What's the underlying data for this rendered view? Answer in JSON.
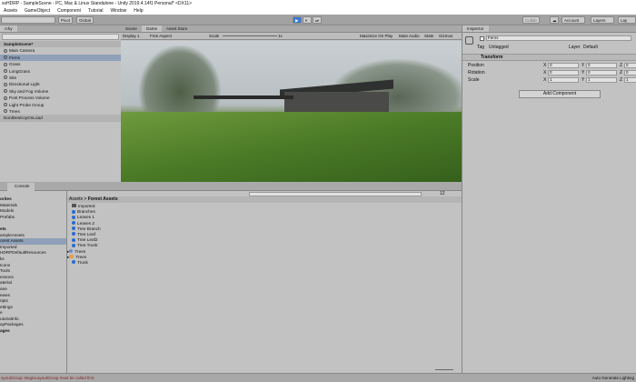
{
  "window": {
    "title": "ssHDRP - SampleScene - PC, Mac & Linux Standalone - Unity 2019.4.14f1 Personal* <DX11>"
  },
  "menu": [
    "Assets",
    "GameObject",
    "Component",
    "Tutorial",
    "Window",
    "Help"
  ],
  "toolbar": {
    "pivot": "Pivot",
    "global": "Global",
    "collab": "Collab",
    "account": "Account",
    "layers": "Layers",
    "layout": "Lay"
  },
  "hierarchy": {
    "tab": "rchy",
    "scene": "SampleScene*",
    "items": [
      "Main Camera",
      "Ferns",
      "Grass",
      "LongGrass",
      "Site",
      "Directional Light",
      "Sky and Fog Volume",
      "Post Process Volume",
      "Light Probe Group",
      "Trees"
    ],
    "selected": "Ferns",
    "dontdestroy": "DontDestroyOnLoad"
  },
  "game": {
    "tabs": [
      "Scene",
      "Game",
      "Asset Store"
    ],
    "active_tab": "Game",
    "display": "Display 1",
    "aspect": "Free Aspect",
    "scale_label": "Scale",
    "scale_value": "1x",
    "options": [
      "Maximize On Play",
      "Mute Audio",
      "Stats",
      "Gizmos"
    ]
  },
  "inspector": {
    "tab": "Inspector",
    "object_name": "Ferns",
    "tag_label": "Tag",
    "tag": "Untagged",
    "layer_label": "Layer",
    "layer": "Default",
    "component": "Transform",
    "rows": [
      {
        "label": "Position",
        "x": "0",
        "y": "0",
        "z": "0"
      },
      {
        "label": "Rotation",
        "x": "0",
        "y": "0",
        "z": "0"
      },
      {
        "label": "Scale",
        "x": "1",
        "y": "1",
        "z": "1"
      }
    ],
    "add_component": "Add Component"
  },
  "console": {
    "tab": "Console"
  },
  "project": {
    "tree": [
      {
        "label": "orites",
        "bold": true
      },
      {
        "label": "Materials"
      },
      {
        "label": "Models"
      },
      {
        "label": "Prefabs"
      },
      {
        "label": ""
      },
      {
        "label": "ets",
        "bold": true
      },
      {
        "label": "ampleAssets"
      },
      {
        "label": "orest Assets",
        "selected": true
      },
      {
        "label": "Imported"
      },
      {
        "label": "HDRPDefaultResources"
      },
      {
        "label": "ks"
      },
      {
        "label": "Icons"
      },
      {
        "label": "Tools"
      },
      {
        "label": "essons"
      },
      {
        "label": "aterial"
      },
      {
        "label": "ane"
      },
      {
        "label": "ewes"
      },
      {
        "label": "ripts"
      },
      {
        "label": "ettings"
      },
      {
        "label": "e"
      },
      {
        "label": "utorialInfo"
      },
      {
        "label": "ayPackages"
      },
      {
        "label": "ages",
        "bold": true
      }
    ],
    "breadcrumb": [
      "Assets",
      "Forest Assets"
    ],
    "items": [
      {
        "label": "Imported",
        "icon": "folder"
      },
      {
        "label": "Branches",
        "icon": "material"
      },
      {
        "label": "Leaves 1",
        "icon": "material"
      },
      {
        "label": "Leaves 2",
        "icon": "material"
      },
      {
        "label": "Tree Branch",
        "icon": "material"
      },
      {
        "label": "Tree Leaf",
        "icon": "material"
      },
      {
        "label": "Tree Leaf2",
        "icon": "material"
      },
      {
        "label": "Tree Trunk",
        "icon": "material"
      },
      {
        "label": "Trees",
        "icon": "prefab",
        "expandable": true
      },
      {
        "label": "Trees",
        "icon": "model",
        "expandable": true
      },
      {
        "label": "Trunk",
        "icon": "material"
      }
    ],
    "count": "12"
  },
  "status": {
    "error": "ayoutGroup: BeginLayoutGroup must be called first.",
    "lighting": "Auto Generate Lighting"
  }
}
